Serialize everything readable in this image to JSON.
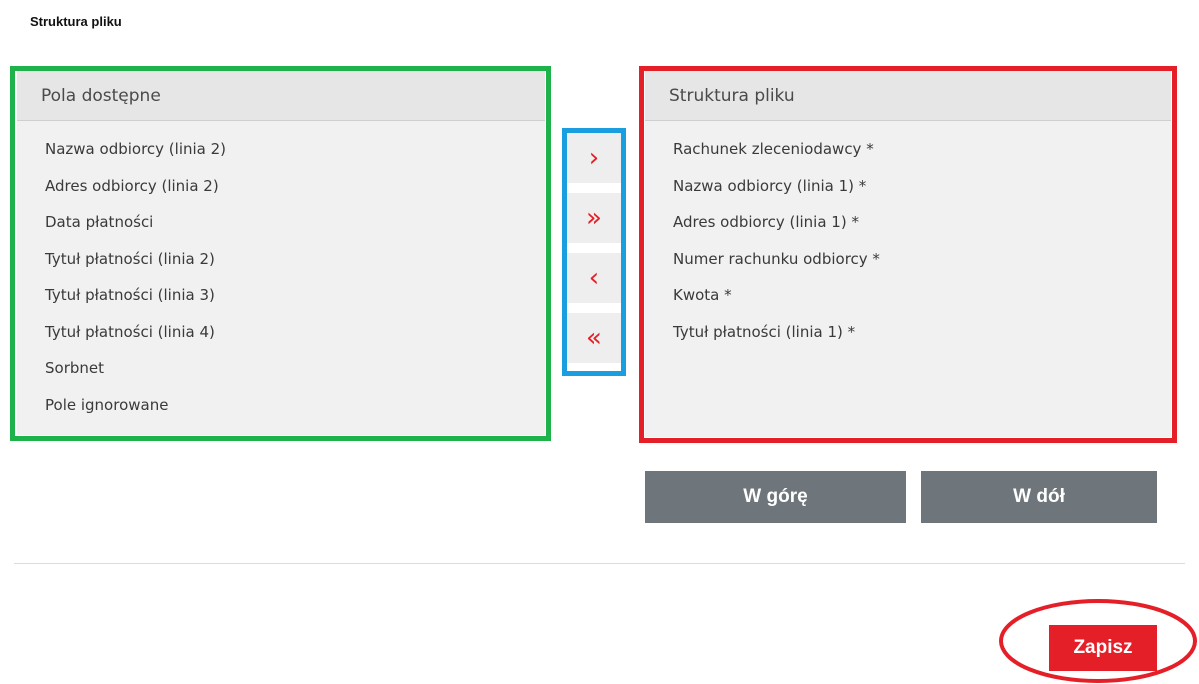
{
  "page": {
    "section_title": "Struktura pliku"
  },
  "available": {
    "header": "Pola dostępne",
    "items": [
      "Nazwa odbiorcy (linia 2)",
      "Adres odbiorcy (linia 2)",
      "Data płatności",
      "Tytuł płatności (linia 2)",
      "Tytuł płatności (linia 3)",
      "Tytuł płatności (linia 4)",
      "Sorbnet",
      "Pole ignorowane"
    ]
  },
  "structure": {
    "header": "Struktura pliku",
    "items": [
      "Rachunek zleceniodawcy *",
      "Nazwa odbiorcy (linia 1) *",
      "Adres odbiorcy (linia 1) *",
      "Numer rachunku odbiorcy *",
      "Kwota *",
      "Tytuł płatności (linia 1) *"
    ]
  },
  "transfer": {
    "move_right": "›",
    "move_all_right": "»",
    "move_left": "‹",
    "move_all_left": "«"
  },
  "icons": {
    "move_right": "chevron-right-icon",
    "move_all_right": "double-chevron-right-icon",
    "move_left": "chevron-left-icon",
    "move_all_left": "double-chevron-left-icon"
  },
  "buttons": {
    "up": "W górę",
    "down": "W dół",
    "save": "Zapisz"
  },
  "colors": {
    "accent_red": "#e41f28",
    "green_highlight": "#1eb24b",
    "blue_highlight": "#1a9ee0",
    "grey_button": "#6f767b"
  }
}
